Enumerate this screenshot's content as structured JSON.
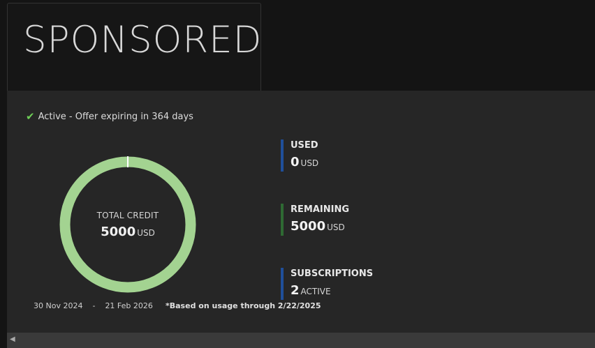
{
  "tab": {
    "title": "SPONSORED"
  },
  "status": {
    "check_icon": "checkmark-icon",
    "text": "Active - Offer expiring in 364 days",
    "color": "#6ecf57"
  },
  "credit": {
    "label": "TOTAL CREDIT",
    "value": "5000",
    "unit": "USD",
    "used_fraction": 0,
    "ring_color": "#a3d391",
    "marker_color": "#ffffff"
  },
  "metrics": {
    "used": {
      "label": "USED",
      "value": "0",
      "unit": "USD",
      "color": "#1f4f9a"
    },
    "remaining": {
      "label": "REMAINING",
      "value": "5000",
      "unit": "USD",
      "color": "#2f6a33"
    },
    "subscriptions": {
      "label": "SUBSCRIPTIONS",
      "value": "2",
      "unit": "ACTIVE",
      "color": "#1f4f9a"
    }
  },
  "period": {
    "start": "30 Nov 2024",
    "separator": "-",
    "end": "21 Feb 2026"
  },
  "footnote": "*Based on usage through 2/22/2025",
  "scrollbar": {
    "left_arrow_icon": "triangle-left-icon"
  }
}
